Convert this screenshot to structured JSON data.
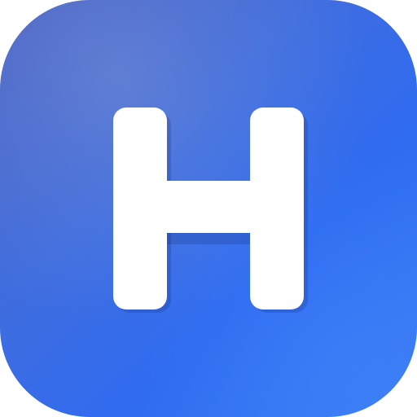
{
  "app_icon": {
    "letter": "H",
    "icon_name": "letter-h-icon",
    "colors": {
      "background_top_left": "#4a63c4",
      "background_mid": "#3f6de0",
      "background_bottom_right": "#3b7cf4",
      "glyph": "#ffffff"
    }
  }
}
